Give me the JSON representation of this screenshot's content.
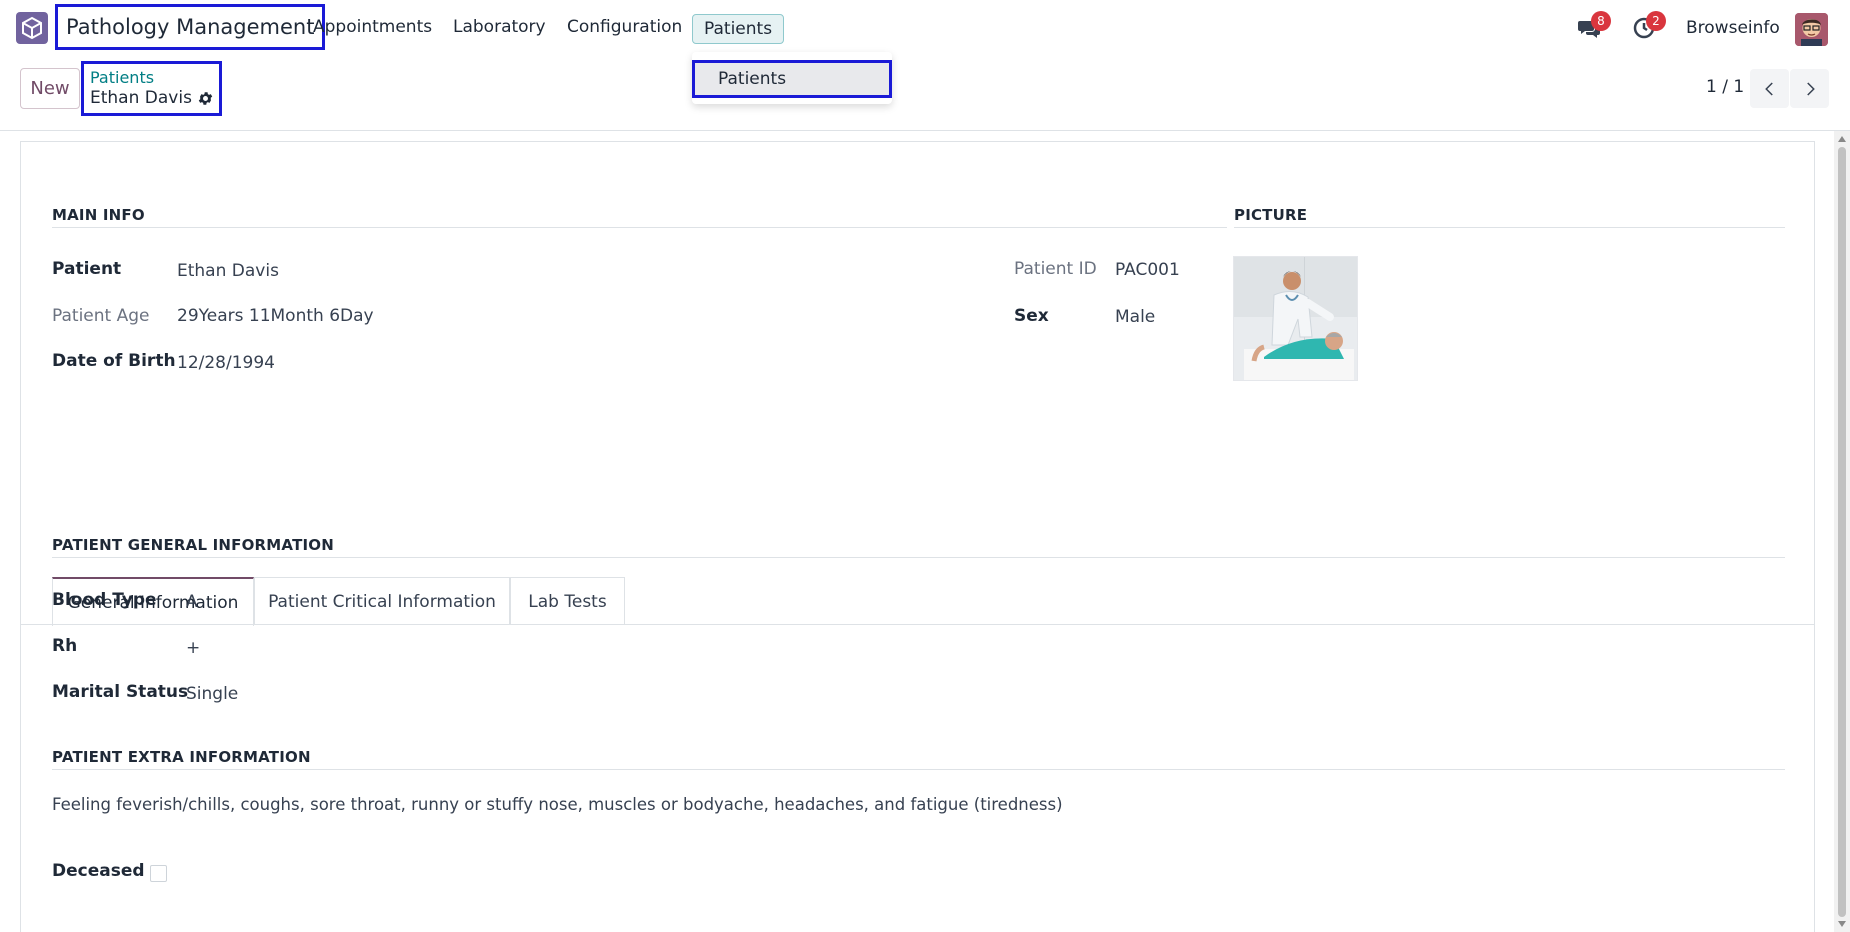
{
  "navbar": {
    "app_title": "Pathology Management",
    "menu": [
      "Appointments",
      "Laboratory",
      "Configuration"
    ],
    "active_menu": "Patients",
    "dropdown_items": [
      "Patients"
    ],
    "messages_count": "8",
    "activities_count": "2",
    "user_name": "Browseinfo"
  },
  "control_panel": {
    "new_label": "New",
    "breadcrumb_parent": "Patients",
    "breadcrumb_current": "Ethan Davis",
    "pager_value": "1 / 1"
  },
  "main_info": {
    "section_title": "MAIN INFO",
    "patient_label": "Patient",
    "patient_value": "Ethan Davis",
    "age_label": "Patient Age",
    "age_value": "29Years 11Month 6Day",
    "dob_label": "Date of Birth",
    "dob_value": "12/28/1994",
    "patient_id_label": "Patient ID",
    "patient_id_value": "PAC001",
    "sex_label": "Sex",
    "sex_value": "Male"
  },
  "picture": {
    "section_title": "PICTURE"
  },
  "tabs": [
    "General Information",
    "Patient Critical Information",
    "Lab Tests"
  ],
  "general": {
    "section_title": "PATIENT GENERAL INFORMATION",
    "blood_type_label": "Blood Type",
    "blood_type_value": "A",
    "rh_label": "Rh",
    "rh_value": "+",
    "marital_label": "Marital Status",
    "marital_value": "Single",
    "extra_title": "PATIENT EXTRA INFORMATION",
    "extra_text": "Feeling feverish/chills, coughs, sore throat, runny or stuffy nose, muscles or bodyache, headaches, and fatigue (tiredness)",
    "deceased_label": "Deceased",
    "deceased_checked": false
  },
  "colors": {
    "brand": "#714b67",
    "link": "#017e84",
    "highlight_box": "#1a1ad6",
    "badge": "#d9363e"
  }
}
